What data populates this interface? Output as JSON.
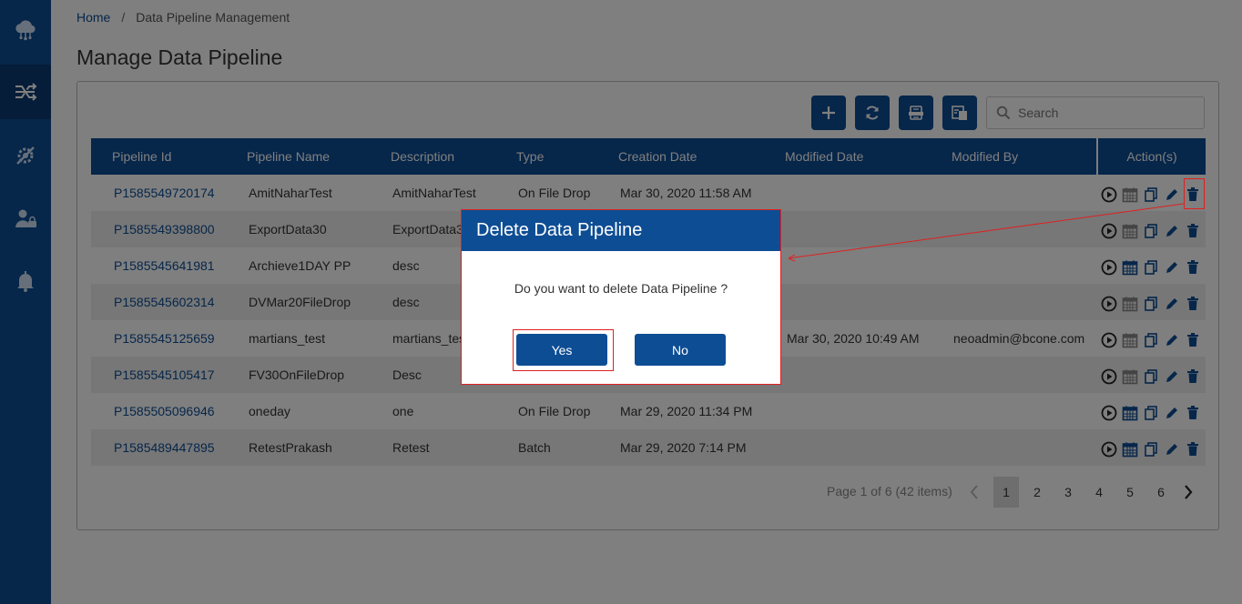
{
  "sidebar": {
    "items": [
      {
        "icon": "cloud-network-icon",
        "active": false
      },
      {
        "icon": "pipeline-shuffle-icon",
        "active": true
      },
      {
        "icon": "gear-tools-icon",
        "active": false
      },
      {
        "icon": "user-lock-icon",
        "active": false
      },
      {
        "icon": "bell-icon",
        "active": false
      }
    ]
  },
  "breadcrumb": {
    "home": "Home",
    "separator": "/",
    "current": "Data Pipeline Management"
  },
  "page_title": "Manage Data Pipeline",
  "toolbar": {
    "buttons": [
      "plus-icon",
      "refresh-icon",
      "export-xlsx-icon",
      "export-file-icon"
    ],
    "search_placeholder": "Search"
  },
  "table": {
    "columns": [
      "Pipeline Id",
      "Pipeline Name",
      "Description",
      "Type",
      "Creation Date",
      "Modified Date",
      "Modified By",
      "Action(s)"
    ],
    "rows": [
      {
        "id": "P1585549720174",
        "name": "AmitNaharTest",
        "desc": "AmitNaharTest",
        "type": "On File Drop",
        "created": "Mar 30, 2020 11:58 AM",
        "modified": "",
        "by": "",
        "scheduled": false
      },
      {
        "id": "P1585549398800",
        "name": "ExportData30",
        "desc": "ExportData30",
        "type": "",
        "created": "",
        "modified": "",
        "by": "",
        "scheduled": false
      },
      {
        "id": "P1585545641981",
        "name": "Archieve1DAY PP",
        "desc": "desc",
        "type": "",
        "created": "",
        "modified": "",
        "by": "",
        "scheduled": true
      },
      {
        "id": "P1585545602314",
        "name": "DVMar20FileDrop",
        "desc": "desc",
        "type": "",
        "created": "",
        "modified": "",
        "by": "",
        "scheduled": false
      },
      {
        "id": "P1585545125659",
        "name": "martians_test",
        "desc": "martians_test",
        "type": "",
        "created": "",
        "modified": "Mar 30, 2020 10:49 AM",
        "by": "neoadmin@bcone.com",
        "scheduled": false
      },
      {
        "id": "P1585545105417",
        "name": "FV30OnFileDrop",
        "desc": "Desc",
        "type": "",
        "created": "",
        "modified": "",
        "by": "",
        "scheduled": false
      },
      {
        "id": "P1585505096946",
        "name": "oneday",
        "desc": "one",
        "type": "On File Drop",
        "created": "Mar 29, 2020 11:34 PM",
        "modified": "",
        "by": "",
        "scheduled": true
      },
      {
        "id": "P1585489447895",
        "name": "RetestPrakash",
        "desc": "Retest",
        "type": "Batch",
        "created": "Mar 29, 2020 7:14 PM",
        "modified": "",
        "by": "",
        "scheduled": true
      }
    ]
  },
  "pagination": {
    "info": "Page 1 of 6 (42 items)",
    "pages": [
      "1",
      "2",
      "3",
      "4",
      "5",
      "6"
    ],
    "current": "1"
  },
  "dialog": {
    "title": "Delete Data Pipeline",
    "message": "Do you want to delete Data Pipeline ?",
    "yes": "Yes",
    "no": "No"
  },
  "colors": {
    "primary": "#0d4d94",
    "highlight": "#e02020"
  }
}
